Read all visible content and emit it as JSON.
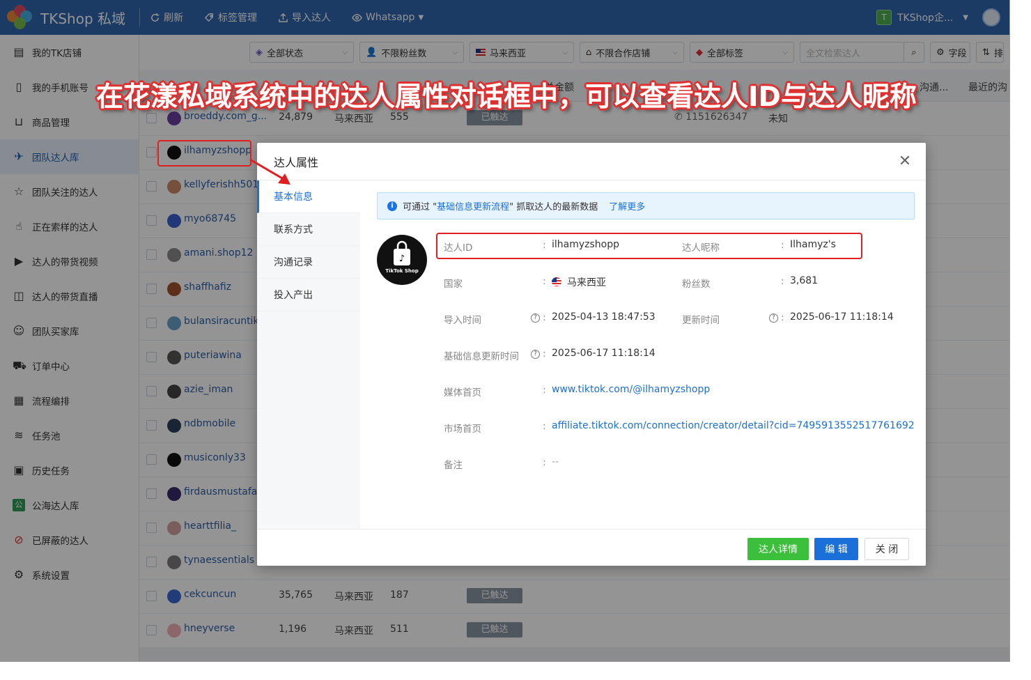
{
  "header": {
    "app_name": "TKShop 私域",
    "buttons": [
      "刷新",
      "标签管理",
      "导入达人",
      "Whatsapp"
    ],
    "account_badge": "T",
    "account_name": "TKShop企..."
  },
  "sidebar": {
    "items": [
      {
        "label": "我的TK店铺",
        "icon": "store-icon"
      },
      {
        "label": "我的手机账号",
        "icon": "phone-icon"
      },
      {
        "label": "商品管理",
        "icon": "cart-icon"
      },
      {
        "label": "团队达人库",
        "icon": "bird-icon",
        "active": true
      },
      {
        "label": "团队关注的达人",
        "icon": "star-icon"
      },
      {
        "label": "正在索样的达人",
        "icon": "hand-icon"
      },
      {
        "label": "达人的带货视频",
        "icon": "video-icon"
      },
      {
        "label": "达人的带货直播",
        "icon": "live-icon"
      },
      {
        "label": "团队买家库",
        "icon": "buyer-icon"
      },
      {
        "label": "订单中心",
        "icon": "truck-icon"
      },
      {
        "label": "流程编排",
        "icon": "calendar-icon"
      },
      {
        "label": "任务池",
        "icon": "layers-icon"
      },
      {
        "label": "历史任务",
        "icon": "clipboard-icon"
      },
      {
        "label": "公海达人库",
        "icon": "public-icon"
      },
      {
        "label": "已屏蔽的达人",
        "icon": "block-icon"
      },
      {
        "label": "系统设置",
        "icon": "gear-icon"
      }
    ]
  },
  "filters": {
    "status": "全部状态",
    "fans": "不限粉丝数",
    "region": "马来西亚",
    "shop": "不限合作店铺",
    "tags": "全部标签",
    "search_placeholder": "全文检索达人",
    "fields_label": "字段",
    "sort_label": "排"
  },
  "table": {
    "header_fragments": [
      "总金额",
      "沟通...",
      "最近的沟"
    ],
    "rows": [
      {
        "name": "broeddy.com_g...",
        "fans": "24,879",
        "region": "马来西亚",
        "num": "555",
        "tag": "已触达",
        "phone": "1151626347",
        "extra": "未知",
        "avatar_color": "#6b3fa0"
      },
      {
        "name": "ilhamyzshopp",
        "avatar_color": "#111111"
      },
      {
        "name": "kellyferishh501",
        "avatar_color": "#c98a6a"
      },
      {
        "name": "myo68745",
        "avatar_color": "#3a5fcf"
      },
      {
        "name": "amani.shop12",
        "avatar_color": "#8a8a8a"
      },
      {
        "name": "shaffhafiz",
        "avatar_color": "#a0522d"
      },
      {
        "name": "bulansiracuntikt",
        "avatar_color": "#6aa0c8"
      },
      {
        "name": "puteriawina",
        "avatar_color": "#555555"
      },
      {
        "name": "azie_iman",
        "avatar_color": "#444444"
      },
      {
        "name": "ndbmobile",
        "avatar_color": "#2b3f5a"
      },
      {
        "name": "musiconly33",
        "avatar_color": "#111111"
      },
      {
        "name": "firdausmustafa0",
        "avatar_color": "#3a2a6a"
      },
      {
        "name": "hearttfilia_",
        "avatar_color": "#d4a0a0"
      },
      {
        "name": "tynaessentials",
        "avatar_color": "#7a7a7a"
      },
      {
        "name": "cekcuncun",
        "fans": "35,765",
        "region": "马来西亚",
        "num": "187",
        "tag": "已触达",
        "avatar_color": "#3a6ad0"
      },
      {
        "name": "hneyverse",
        "fans": "1,196",
        "region": "马来西亚",
        "num": "511",
        "tag": "已触达",
        "avatar_color": "#f0b0b8"
      }
    ]
  },
  "dialog": {
    "title": "达人属性",
    "tabs": [
      "基本信息",
      "联系方式",
      "沟通记录",
      "投入产出"
    ],
    "notice": {
      "prefix": "可通过 \"",
      "link": "基础信息更新流程",
      "suffix": "\" 抓取达人的最新数据",
      "learn_more": "了解更多"
    },
    "avatar_text": "TikTok Shop",
    "fields": {
      "id_label": "达人ID",
      "id_value": "ilhamyzshopp",
      "nick_label": "达人昵称",
      "nick_value": "Ilhamyz's",
      "country_label": "国家",
      "country_value": "马来西亚",
      "fans_label": "粉丝数",
      "fans_value": "3,681",
      "import_label": "导入时间",
      "import_value": "2025-04-13 18:47:53",
      "update_label": "更新时间",
      "update_value": "2025-06-17 11:18:14",
      "basic_update_label": "基础信息更新时间",
      "basic_update_value": "2025-06-17 11:18:14",
      "media_label": "媒体首页",
      "media_value": "www.tiktok.com/@ilhamyzshopp",
      "market_label": "市场首页",
      "market_value": "affiliate.tiktok.com/connection/creator/detail?cid=7495913552517761692",
      "remark_label": "备注",
      "remark_value": "--"
    },
    "buttons": {
      "detail": "达人详情",
      "edit": "编 辑",
      "close": "关 闭"
    }
  },
  "annotation": {
    "banner": "在花漾私域系统中的达人属性对话框中，可以查看达人ID与达人昵称"
  },
  "colors": {
    "header": "#2f67ad",
    "primary": "#1a6fd8",
    "success": "#3cc03c",
    "annotation": "#e02020"
  }
}
